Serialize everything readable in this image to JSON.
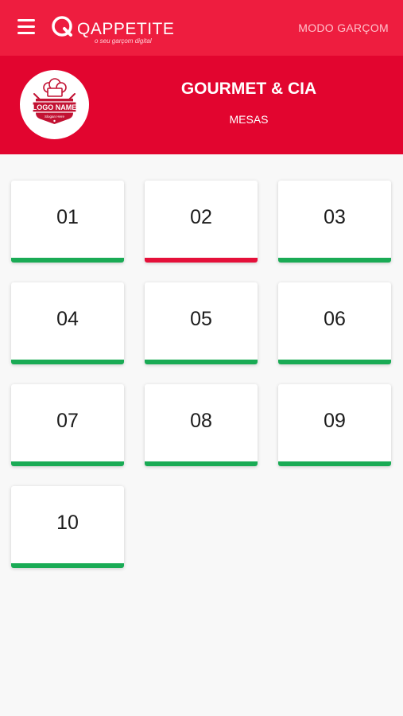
{
  "topbar": {
    "brand": "QAPPETITE",
    "tagline": "o seu garçom digital",
    "mode_link": "MODO GARÇOM",
    "menu_icon": "hamburger-icon"
  },
  "restaurant": {
    "name": "GOURMET & CIA",
    "section": "MESAS",
    "logo": {
      "title": "LOGO NAME",
      "slogan": "Slogan Here"
    }
  },
  "colors": {
    "topbar": "#ee1d3f",
    "header": "#e2052f",
    "status_free": "#1aab55",
    "status_occupied": "#e5103a"
  },
  "tables": [
    {
      "number": "01",
      "status": "free"
    },
    {
      "number": "02",
      "status": "occupied"
    },
    {
      "number": "03",
      "status": "free"
    },
    {
      "number": "04",
      "status": "free"
    },
    {
      "number": "05",
      "status": "free"
    },
    {
      "number": "06",
      "status": "free"
    },
    {
      "number": "07",
      "status": "free"
    },
    {
      "number": "08",
      "status": "free"
    },
    {
      "number": "09",
      "status": "free"
    },
    {
      "number": "10",
      "status": "free"
    }
  ]
}
